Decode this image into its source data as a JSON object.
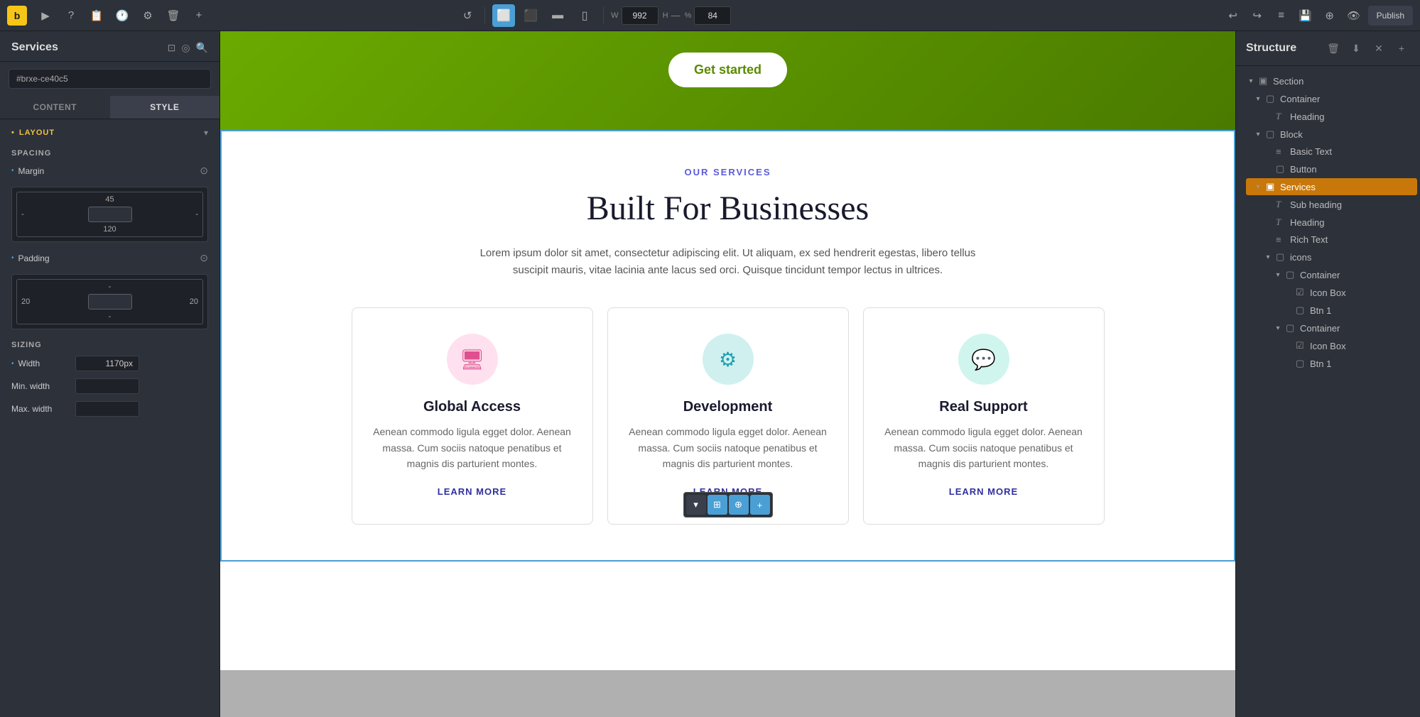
{
  "app": {
    "logo": "b",
    "title": "Services"
  },
  "toolbar": {
    "icons": [
      "▶",
      "?",
      "📋",
      "🕐",
      "⚙",
      "🗑",
      "+"
    ],
    "refresh_icon": "↺",
    "devices": [
      {
        "id": "desktop",
        "icon": "⬜",
        "active": true
      },
      {
        "id": "tablet-landscape",
        "icon": "⬛"
      },
      {
        "id": "tablet",
        "icon": "▬"
      },
      {
        "id": "mobile",
        "icon": "▯"
      }
    ],
    "width_label": "W",
    "width_value": "992",
    "height_label": "H",
    "height_value": "",
    "percent_label": "%",
    "percent_value": "84",
    "undo_icon": "↩",
    "redo_icon": "↪",
    "menu_icon": "≡",
    "save_icon": "💾",
    "wp_icon": "⊕",
    "eye_icon": "👁",
    "publish_label": "Publish"
  },
  "left_panel": {
    "title": "Services",
    "search_placeholder": "#brxe-ce40c5",
    "tabs": [
      {
        "id": "content",
        "label": "CONTENT"
      },
      {
        "id": "style",
        "label": "STYLE",
        "active": true
      }
    ],
    "layout_section": {
      "label": "LAYOUT",
      "spacing": {
        "label": "SPACING",
        "margin_label": "Margin",
        "margin_top": "45",
        "margin_bottom": "120",
        "margin_left": "-",
        "margin_right": "-",
        "padding_label": "Padding",
        "padding_top": "-",
        "padding_bottom": "-",
        "padding_left": "20",
        "padding_right": "20"
      },
      "sizing": {
        "label": "SIZING",
        "width_label": "Width",
        "width_value": "1170px",
        "min_width_label": "Min. width",
        "min_width_value": "",
        "max_width_label": "Max. width",
        "max_width_value": ""
      }
    }
  },
  "canvas": {
    "hero": {
      "button_label": "Get started"
    },
    "services": {
      "eyebrow": "OUR SERVICES",
      "heading": "Built For Businesses",
      "description": "Lorem ipsum dolor sit amet, consectetur adipiscing elit. Ut aliquam, ex sed hendrerit egestas, libero tellus suscipit mauris, vitae lacinia ante lacus sed orci. Quisque tincidunt tempor lectus in ultrices.",
      "cards": [
        {
          "icon": "🖥",
          "icon_style": "pink",
          "title": "Global Access",
          "text": "Aenean commodo ligula egget dolor. Aenean massa. Cum sociis natoque penatibus et magnis dis parturient montes.",
          "link": "LEARN MORE"
        },
        {
          "icon": "⚙",
          "icon_style": "teal",
          "title": "Development",
          "text": "Aenean commodo ligula egget dolor. Aenean massa. Cum sociis natoque penatibus et magnis dis parturient montes.",
          "link": "LEARN MORE"
        },
        {
          "icon": "💬",
          "icon_style": "green",
          "title": "Real Support",
          "text": "Aenean commodo ligula egget dolor. Aenean massa. Cum sociis natoque penatibus et magnis dis parturient montes.",
          "link": "LEARN MORE"
        }
      ]
    },
    "overlay_toolbar": {
      "buttons": [
        "▾",
        "⊞",
        "⊕",
        "+"
      ]
    }
  },
  "right_panel": {
    "title": "Structure",
    "tree": [
      {
        "id": "section",
        "label": "Section",
        "icon": "▣",
        "indent": 0,
        "arrow": "▾",
        "expanded": true
      },
      {
        "id": "container",
        "label": "Container",
        "icon": "▢",
        "indent": 1,
        "arrow": "▾",
        "expanded": true
      },
      {
        "id": "heading",
        "label": "Heading",
        "icon": "T",
        "indent": 2,
        "arrow": "",
        "expanded": false
      },
      {
        "id": "block",
        "label": "Block",
        "icon": "▢",
        "indent": 1,
        "arrow": "▾",
        "expanded": true
      },
      {
        "id": "basic-text",
        "label": "Basic Text",
        "icon": "≡",
        "indent": 2,
        "arrow": "",
        "expanded": false
      },
      {
        "id": "button",
        "label": "Button",
        "icon": "▢",
        "indent": 2,
        "arrow": "",
        "expanded": false
      },
      {
        "id": "services",
        "label": "Services",
        "icon": "▣",
        "indent": 1,
        "arrow": "▾",
        "expanded": true,
        "selected": true
      },
      {
        "id": "subheading",
        "label": "Sub heading",
        "icon": "T",
        "indent": 2,
        "arrow": "",
        "expanded": false
      },
      {
        "id": "heading2",
        "label": "Heading",
        "icon": "T",
        "indent": 2,
        "arrow": "",
        "expanded": false
      },
      {
        "id": "rich-text",
        "label": "Rich Text",
        "icon": "≡",
        "indent": 2,
        "arrow": "",
        "expanded": false
      },
      {
        "id": "icons",
        "label": "icons",
        "icon": "▢",
        "indent": 2,
        "arrow": "▾",
        "expanded": true
      },
      {
        "id": "container2",
        "label": "Container",
        "icon": "▢",
        "indent": 3,
        "arrow": "▾",
        "expanded": true
      },
      {
        "id": "icon-box1",
        "label": "Icon Box",
        "icon": "☑",
        "indent": 4,
        "arrow": "",
        "expanded": false
      },
      {
        "id": "btn1",
        "label": "Btn 1",
        "icon": "▢",
        "indent": 4,
        "arrow": "",
        "expanded": false
      },
      {
        "id": "container3",
        "label": "Container",
        "icon": "▢",
        "indent": 3,
        "arrow": "▾",
        "expanded": true
      },
      {
        "id": "icon-box2",
        "label": "Icon Box",
        "icon": "☑",
        "indent": 4,
        "arrow": "",
        "expanded": false
      },
      {
        "id": "btn2",
        "label": "Btn 1",
        "icon": "▢",
        "indent": 4,
        "arrow": "",
        "expanded": false
      }
    ]
  }
}
